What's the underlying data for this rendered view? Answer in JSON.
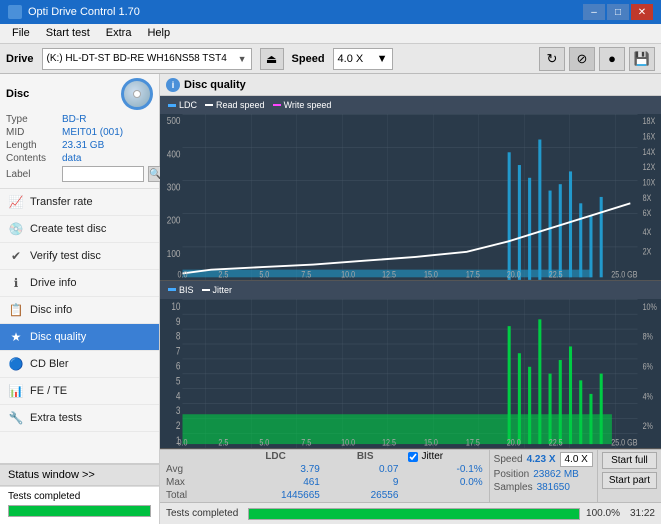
{
  "app": {
    "title": "Opti Drive Control 1.70",
    "icon": "ODC"
  },
  "titlebar": {
    "title": "Opti Drive Control 1.70",
    "minimize": "–",
    "maximize": "□",
    "close": "✕"
  },
  "menubar": {
    "items": [
      "File",
      "Start test",
      "Extra",
      "Help"
    ]
  },
  "drivebar": {
    "label": "Drive",
    "drive_name": "(K:)  HL-DT-ST BD-RE  WH16NS58 TST4",
    "speed_label": "Speed",
    "speed_value": "4.0 X"
  },
  "disc": {
    "section_label": "Disc",
    "type_label": "Type",
    "type_value": "BD-R",
    "mid_label": "MID",
    "mid_value": "MEIT01 (001)",
    "length_label": "Length",
    "length_value": "23.31 GB",
    "contents_label": "Contents",
    "contents_value": "data",
    "label_label": "Label",
    "label_value": ""
  },
  "nav": {
    "items": [
      {
        "id": "transfer-rate",
        "label": "Transfer rate",
        "icon": "📈"
      },
      {
        "id": "create-test-disc",
        "label": "Create test disc",
        "icon": "💿"
      },
      {
        "id": "verify-test-disc",
        "label": "Verify test disc",
        "icon": "✔"
      },
      {
        "id": "drive-info",
        "label": "Drive info",
        "icon": "ℹ"
      },
      {
        "id": "disc-info",
        "label": "Disc info",
        "icon": "📋"
      },
      {
        "id": "disc-quality",
        "label": "Disc quality",
        "icon": "★",
        "active": true
      },
      {
        "id": "cd-bler",
        "label": "CD Bler",
        "icon": "🔵"
      },
      {
        "id": "fe-te",
        "label": "FE / TE",
        "icon": "📊"
      },
      {
        "id": "extra-tests",
        "label": "Extra tests",
        "icon": "🔧"
      }
    ]
  },
  "status_window": {
    "button_label": "Status window >>",
    "completed_text": "Tests completed",
    "progress_percent": 100,
    "progress_display": "100.0%",
    "time": "31:22"
  },
  "chart": {
    "title": "Disc quality",
    "legend_ldc": "LDC",
    "legend_read": "Read speed",
    "legend_write": "Write speed",
    "legend_bis": "BIS",
    "legend_jitter": "Jitter",
    "top_y_max": 500,
    "top_y_labels": [
      "500",
      "400",
      "300",
      "200",
      "100",
      "0"
    ],
    "top_y_right": [
      "18X",
      "16X",
      "14X",
      "12X",
      "10X",
      "8X",
      "6X",
      "4X",
      "2X"
    ],
    "x_labels": [
      "0.0",
      "2.5",
      "5.0",
      "7.5",
      "10.0",
      "12.5",
      "15.0",
      "17.5",
      "20.0",
      "22.5",
      "25.0 GB"
    ],
    "bottom_y_labels": [
      "10",
      "9",
      "8",
      "7",
      "6",
      "5",
      "4",
      "3",
      "2",
      "1"
    ],
    "bottom_y_right": [
      "10%",
      "8%",
      "6%",
      "4%",
      "2%"
    ]
  },
  "stats": {
    "col_ldc": "LDC",
    "col_bis": "BIS",
    "col_jitter": "Jitter",
    "row_avg": "Avg",
    "row_max": "Max",
    "row_total": "Total",
    "avg_ldc": "3.79",
    "avg_bis": "0.07",
    "avg_jitter": "-0.1%",
    "max_ldc": "461",
    "max_bis": "9",
    "max_jitter": "0.0%",
    "total_ldc": "1445665",
    "total_bis": "26556",
    "speed_label": "Speed",
    "speed_value": "4.23 X",
    "speed_box": "4.0 X",
    "position_label": "Position",
    "position_value": "23862 MB",
    "samples_label": "Samples",
    "samples_value": "381650",
    "jitter_label": "Jitter",
    "start_full_label": "Start full",
    "start_part_label": "Start part"
  }
}
